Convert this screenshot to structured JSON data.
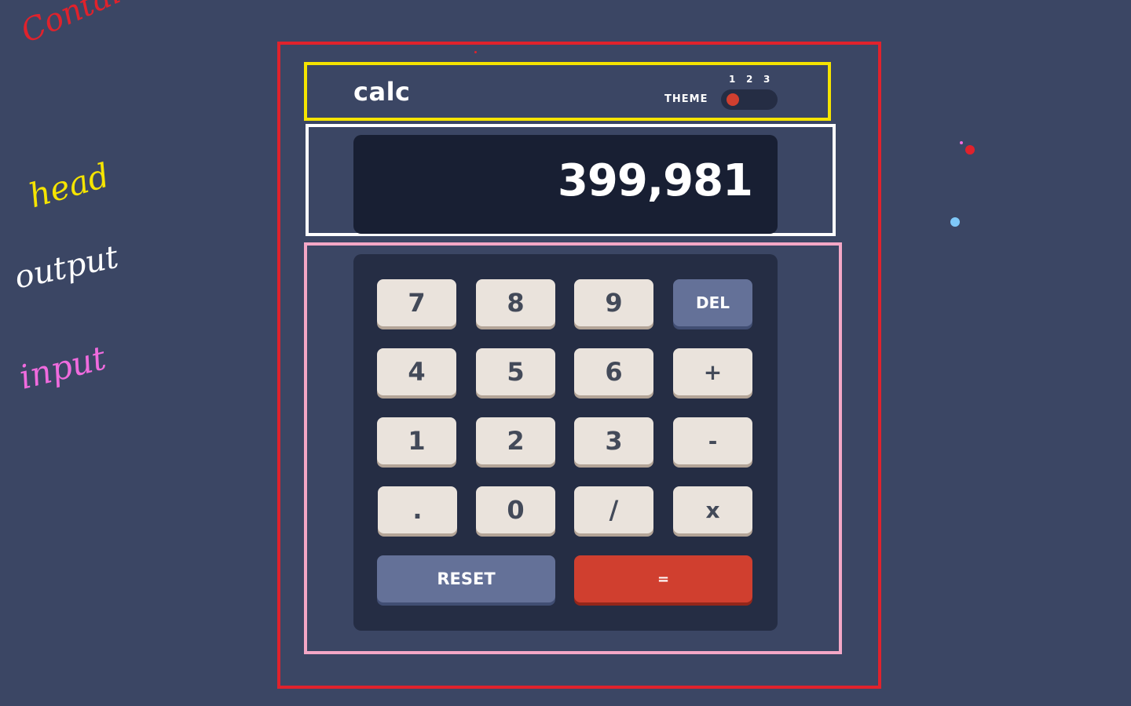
{
  "header": {
    "logo": "calc",
    "theme_label": "THEME",
    "theme_options": [
      "1",
      "2",
      "3"
    ],
    "active_theme": "1"
  },
  "display": {
    "value": "399,981"
  },
  "keys": {
    "row1": [
      "7",
      "8",
      "9",
      "DEL"
    ],
    "row2": [
      "4",
      "5",
      "6",
      "+"
    ],
    "row3": [
      "1",
      "2",
      "3",
      "-"
    ],
    "row4": [
      ".",
      "0",
      "/",
      "x"
    ],
    "reset": "RESET",
    "equals": "="
  },
  "annotations": {
    "container": "Container",
    "head": "head",
    "output": "output",
    "input": "input"
  },
  "colors": {
    "background": "#3b4664",
    "keypad": "#252d44",
    "screen": "#181f33",
    "key": "#eae3dc",
    "key_text": "#434a59",
    "accent_blue": "#647198",
    "accent_red": "#d03f2f",
    "annotation_container": "#e0222c",
    "annotation_head": "#f5e400",
    "annotation_output": "#ffffff",
    "annotation_input": "#f4a7c6"
  }
}
